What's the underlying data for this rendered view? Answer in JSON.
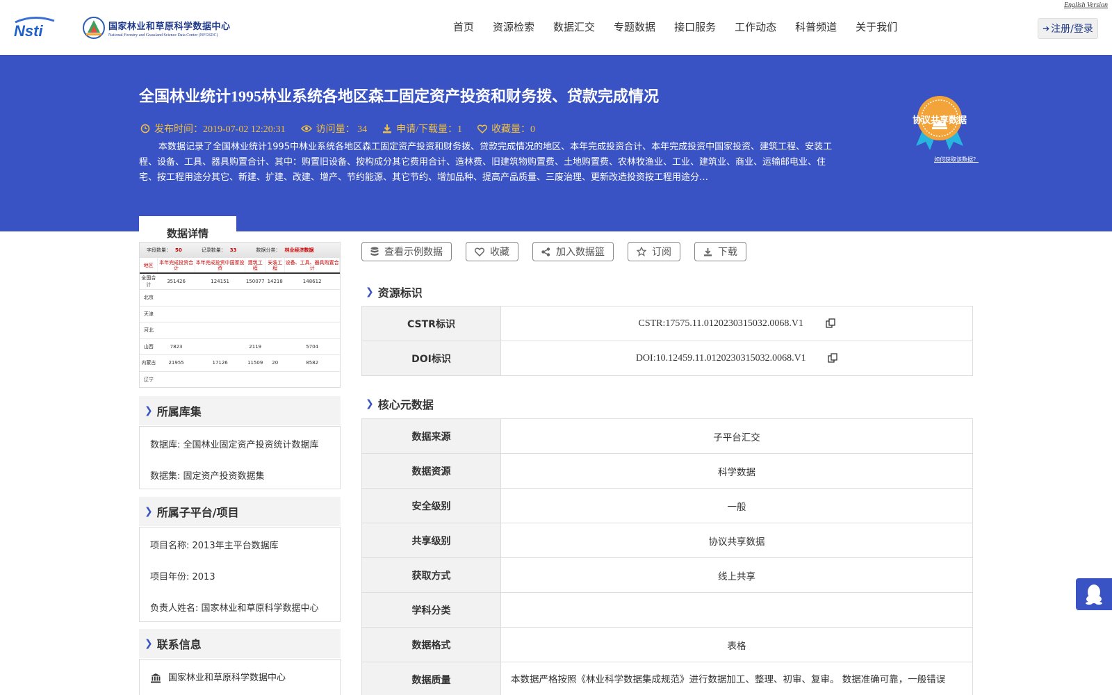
{
  "header": {
    "english_link": "English Version",
    "logo_nsti": "Nsti",
    "center_name_cn": "国家林业和草原科学数据中心",
    "center_name_en": "National Forestry and Grassland Science Data Center (NFGSDC)",
    "nav": [
      "首页",
      "资源检索",
      "数据汇交",
      "专题数据",
      "接口服务",
      "工作动态",
      "科普频道",
      "关于我们"
    ],
    "login": "注册/登录"
  },
  "banner": {
    "title": "全国林业统计1995林业系统各地区森工固定资产投资和财务拨、贷款完成情况",
    "publish_time": "发布时间：2019-07-02 12:20:31",
    "visits": "访问量： 34",
    "downloads": "申请/下载量：1",
    "favorites": "收藏量：0",
    "description": "本数据记录了全国林业统计1995中林业系统各地区森工固定资产投资和财务拨、贷款完成情况的地区、本年完成投资合计、本年完成投资中国家投资、建筑工程、安装工程、设备、工具、器具购置合计、其中：购置旧设备、按构成分其它费用合计、造林费、旧建筑物购置费、土地购置费、农林牧渔业、工业、建筑业、商业、运输邮电业、住宅、按工程用途分其它、新建、扩建、改建、增产、节约能源、其它节约、增加品种、提高产品质量、三废治理、更新改造投资按工程用途分…",
    "badge_text": "协议共享数据",
    "badge_link": "如何获取该数据？",
    "tab": "数据详情"
  },
  "preview": {
    "field_count_label": "字段数量：",
    "field_count": "50",
    "record_count_label": "记录数量：",
    "record_count": "33",
    "category_label": "数据分类：",
    "category": "林业经济数据",
    "columns": [
      "地区",
      "本年完成投资合计",
      "本年完成投资中国家投资",
      "建筑工程",
      "安装工程",
      "设备、工具、器具购置合计"
    ],
    "rows": [
      [
        "全国合计",
        "351426",
        "124151",
        "150077",
        "14218",
        "148612"
      ],
      [
        "北京",
        "",
        "",
        "",
        "",
        ""
      ],
      [
        "天津",
        "",
        "",
        "",
        "",
        ""
      ],
      [
        "河北",
        "",
        "",
        "",
        "",
        ""
      ],
      [
        "山西",
        "7823",
        "",
        "2119",
        "",
        "5704"
      ],
      [
        "内蒙古",
        "21955",
        "17126",
        "11509",
        "20",
        "8582"
      ],
      [
        "辽宁",
        "",
        "",
        "",
        "",
        ""
      ]
    ]
  },
  "library": {
    "heading": "所属库集",
    "database": "数据库: 全国林业固定资产投资统计数据库",
    "dataset": "数据集: 固定资产投资数据集"
  },
  "project": {
    "heading": "所属子平台/项目",
    "name": "项目名称: 2013年主平台数据库",
    "year": "项目年份: 2013",
    "owner": "负责人姓名: 国家林业和草原科学数据中心"
  },
  "contact": {
    "heading": "联系信息",
    "org": "国家林业和草原科学数据中心"
  },
  "actions": {
    "sample": "查看示例数据",
    "favorite": "收藏",
    "basket": "加入数据篮",
    "subscribe": "订阅",
    "download": "下载"
  },
  "identifiers": {
    "heading": "资源标识",
    "cstr_label": "CSTR标识",
    "cstr_value": "CSTR:17575.11.0120230315032.0068.V1",
    "doi_label": "DOI标识",
    "doi_value": "DOI:10.12459.11.0120230315032.0068.V1"
  },
  "core": {
    "heading": "核心元数据",
    "rows": [
      {
        "k": "数据来源",
        "v": "子平台汇交"
      },
      {
        "k": "数据资源",
        "v": "科学数据"
      },
      {
        "k": "安全级别",
        "v": "一般"
      },
      {
        "k": "共享级别",
        "v": "协议共享数据"
      },
      {
        "k": "获取方式",
        "v": "线上共享"
      },
      {
        "k": "学科分类",
        "v": ""
      },
      {
        "k": "数据格式",
        "v": "表格"
      },
      {
        "k": "数据质量",
        "v": "本数据严格按照《林业科学数据集成规范》进行数据加工、整理、初审、复审。 数据准确可靠，一般错误"
      }
    ]
  },
  "colors": {
    "brand_blue": "#3a53c4",
    "meta_gold": "#f0c040",
    "badge_orange": "#f2a33a"
  }
}
